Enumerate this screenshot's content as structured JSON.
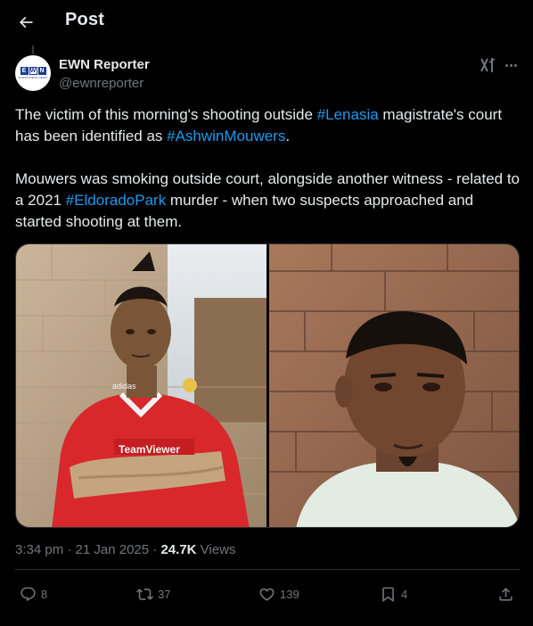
{
  "header": {
    "title": "Post"
  },
  "author": {
    "name": "EWN Reporter",
    "handle": "@ewnreporter",
    "avatar_text": "EWN",
    "avatar_subtext": "EYEWITNESS NEWS"
  },
  "post": {
    "p1_part1": "The victim of this morning's shooting outside ",
    "p1_tag1": "#Lenasia",
    "p1_part2": " magistrate's court has been identified as ",
    "p1_tag2": "#AshwinMouwers",
    "p1_part3": ".",
    "p2_part1": "Mouwers was smoking outside court, alongside another witness - related to a 2021 ",
    "p2_tag": "#EldoradoPark",
    "p2_part2": " murder - when two suspects approached and started shooting at them.",
    "left_photo_text_1": "adidas",
    "left_photo_text_2": "TeamViewer"
  },
  "meta": {
    "time": "3:34 pm",
    "separator": " · ",
    "date": "21 Jan 2025",
    "views_count": "24.7K",
    "views_label": " Views"
  },
  "actions": {
    "replies": "8",
    "reposts": "37",
    "likes": "139",
    "bookmarks": "4"
  },
  "colors": {
    "background": "#000000",
    "text": "#e7e9ea",
    "secondary": "#71767b",
    "link": "#1d9bf0",
    "divider": "#2f3336"
  }
}
